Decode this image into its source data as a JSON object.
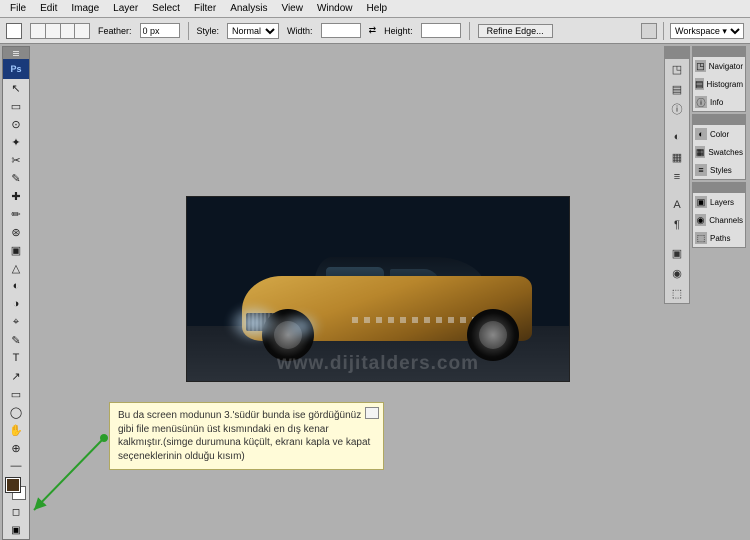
{
  "menu": [
    "File",
    "Edit",
    "Image",
    "Layer",
    "Select",
    "Filter",
    "Analysis",
    "View",
    "Window",
    "Help"
  ],
  "opt": {
    "feather_label": "Feather:",
    "feather_value": "0 px",
    "style_label": "Style:",
    "style_value": "Normal",
    "width_label": "Width:",
    "height_label": "Height:",
    "refine": "Refine Edge...",
    "workspace": "Workspace ▾"
  },
  "ps_label": "Ps",
  "tools": [
    "↖",
    "▭",
    "⊙",
    "✦",
    "✂",
    "✎",
    "✚",
    "✏",
    "⊛",
    "▣",
    "△",
    "◐",
    "◑",
    "⌖",
    "✎",
    "T",
    "↗",
    "▭",
    "◯",
    "✋",
    "⊕",
    "—"
  ],
  "panels": {
    "g1": [
      [
        "◳",
        "Navigator"
      ],
      [
        "▤",
        "Histogram"
      ],
      [
        "ⓘ",
        "Info"
      ]
    ],
    "g2": [
      [
        "◐",
        "Color"
      ],
      [
        "▦",
        "Swatches"
      ],
      [
        "≡",
        "Styles"
      ]
    ],
    "g3": [
      [
        "▣",
        "Layers"
      ],
      [
        "◉",
        "Channels"
      ],
      [
        "⬚",
        "Paths"
      ]
    ]
  },
  "iconcol_extra": [
    "A",
    "¶"
  ],
  "note_text": "Bu da screen modunun 3.'südür bunda ise gördüğünüz gibi file menüsünün üst kısmındaki en dış kenar kalkmıştır.(simge durumuna küçült, ekranı kapla ve kapat seçeneklerinin olduğu kısım)",
  "watermark": "www.dijitalders.com"
}
